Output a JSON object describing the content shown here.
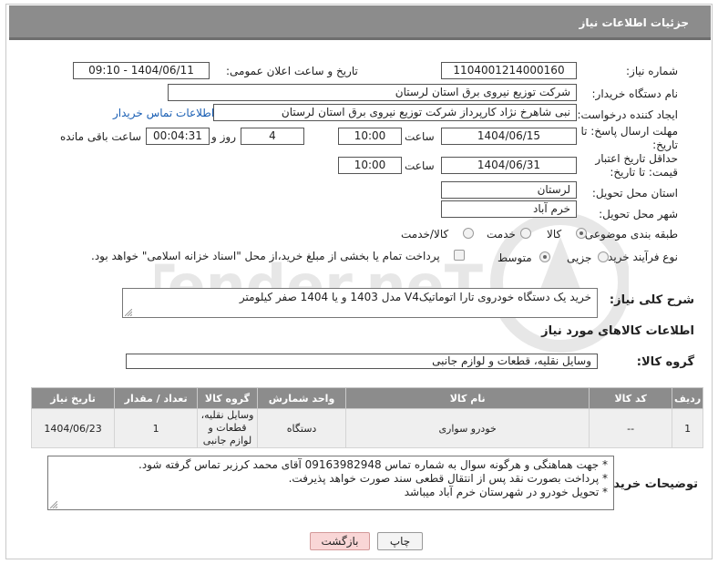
{
  "header": {
    "title": "جزئیات اطلاعات نیاز"
  },
  "fields": {
    "need_number_label": "شماره نیاز:",
    "need_number": "1104001214000160",
    "announce_label": "تاریخ و ساعت اعلان عمومی:",
    "announce_value": "1404/06/11 - 09:10",
    "buyer_org_label": "نام دستگاه خریدار:",
    "buyer_org": "شرکت توزیع نیروی برق استان لرستان",
    "requester_label": "ایجاد کننده درخواست:",
    "requester": "نبی شاهرخ نژاد کارپرداز شرکت توزیع نیروی برق استان لرستان",
    "contact_link": "اطلاعات تماس خریدار",
    "deadline_label": "مهلت ارسال پاسخ: تا تاریخ:",
    "deadline_date": "1404/06/15",
    "time_label": "ساعت",
    "deadline_time": "10:00",
    "days_value": "4",
    "days_label": "روز و",
    "remaining_value": "00:04:31",
    "remaining_label": "ساعت باقی مانده",
    "validity_label": "حداقل تاریخ اعتبار قیمت: تا تاریخ:",
    "validity_date": "1404/06/31",
    "validity_time": "10:00",
    "province_label": "استان محل تحویل:",
    "province": "لرستان",
    "city_label": "شهر محل تحویل:",
    "city": "خرم آباد",
    "category_label": "طبقه بندی موضوعی:",
    "category_goods": "کالا",
    "category_service": "خدمت",
    "category_both": "کالا/خدمت",
    "process_label": "نوع فرآیند خرید :",
    "process_partial": "جزیی",
    "process_medium": "متوسط",
    "process_note": "پرداخت تمام یا بخشی از مبلغ خرید،از محل \"اسناد خزانه اسلامی\" خواهد بود.",
    "summary_label": "شرح کلی نیاز:",
    "summary": "خرید یک دستگاه خودروی تارا اتوماتیکV4 مدل  1403 و یا 1404 صفر کیلومتر",
    "goods_info_title": "اطلاعات کالاهای مورد نیاز",
    "goods_group_label": "گروه کالا:",
    "goods_group": "وسایل نقلیه، قطعات و لوازم جانبی",
    "buyer_notes_label": "توضیحات خریدار:",
    "buyer_notes": [
      "* جهت هماهنگی و هرگونه سوال به شماره تماس 09163982948 آقای محمد کرزبر تماس گرفته شود.",
      "* پرداخت بصورت نقد پس از انتقال قطعی سند صورت خواهد پذیرفت.",
      "* تحویل خودرو در شهرستان خرم آباد میباشد"
    ]
  },
  "table": {
    "headers": [
      "ردیف",
      "کد کالا",
      "نام کالا",
      "واحد شمارش",
      "گروه کالا",
      "تعداد / مقدار",
      "تاریخ نیاز"
    ],
    "rows": [
      [
        "1",
        "--",
        "خودرو سواری",
        "دستگاه",
        "وسایل نقلیه، قطعات و لوازم جانبی",
        "1",
        "1404/06/23"
      ]
    ]
  },
  "buttons": {
    "print": "چاپ",
    "back": "بازگشت"
  },
  "watermark": "AriaTender.neT"
}
